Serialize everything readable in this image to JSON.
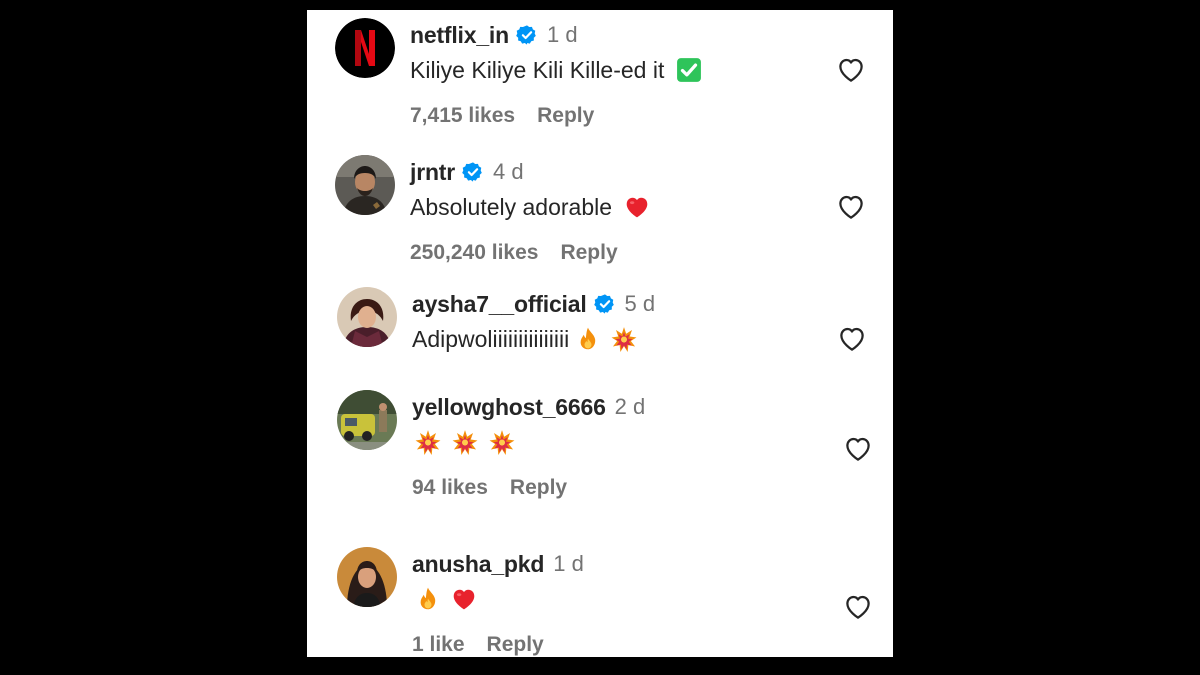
{
  "colors": {
    "background": "#000000",
    "panel": "#ffffff",
    "text": "#262626",
    "muted": "#737373",
    "verified": "#0095f6"
  },
  "comments": [
    {
      "username": "netflix_in",
      "verified": true,
      "time": "1 d",
      "text": "Kiliye Kiliye Kili Kille-ed it",
      "emojis": [
        "check-mark-emoji"
      ],
      "likes": "7,415 likes",
      "reply": "Reply"
    },
    {
      "username": "jrntr",
      "verified": true,
      "time": "4 d",
      "text": "Absolutely adorable",
      "emojis": [
        "red-heart-emoji"
      ],
      "likes": "250,240 likes",
      "reply": "Reply"
    },
    {
      "username": "aysha7__official",
      "verified": true,
      "time": "5 d",
      "text": "Adipwoliiiiiiiiiiiiiii",
      "emojis": [
        "fire-emoji",
        "collision-emoji"
      ],
      "likes": "",
      "reply": ""
    },
    {
      "username": "yellowghost_6666",
      "verified": false,
      "time": "2 d",
      "text": "",
      "emojis": [
        "collision-emoji",
        "collision-emoji",
        "collision-emoji"
      ],
      "likes": "94 likes",
      "reply": "Reply"
    },
    {
      "username": "anusha_pkd",
      "verified": false,
      "time": "1 d",
      "text": "",
      "emojis": [
        "fire-emoji",
        "red-heart-emoji"
      ],
      "likes": "1 like",
      "reply": "Reply"
    }
  ]
}
